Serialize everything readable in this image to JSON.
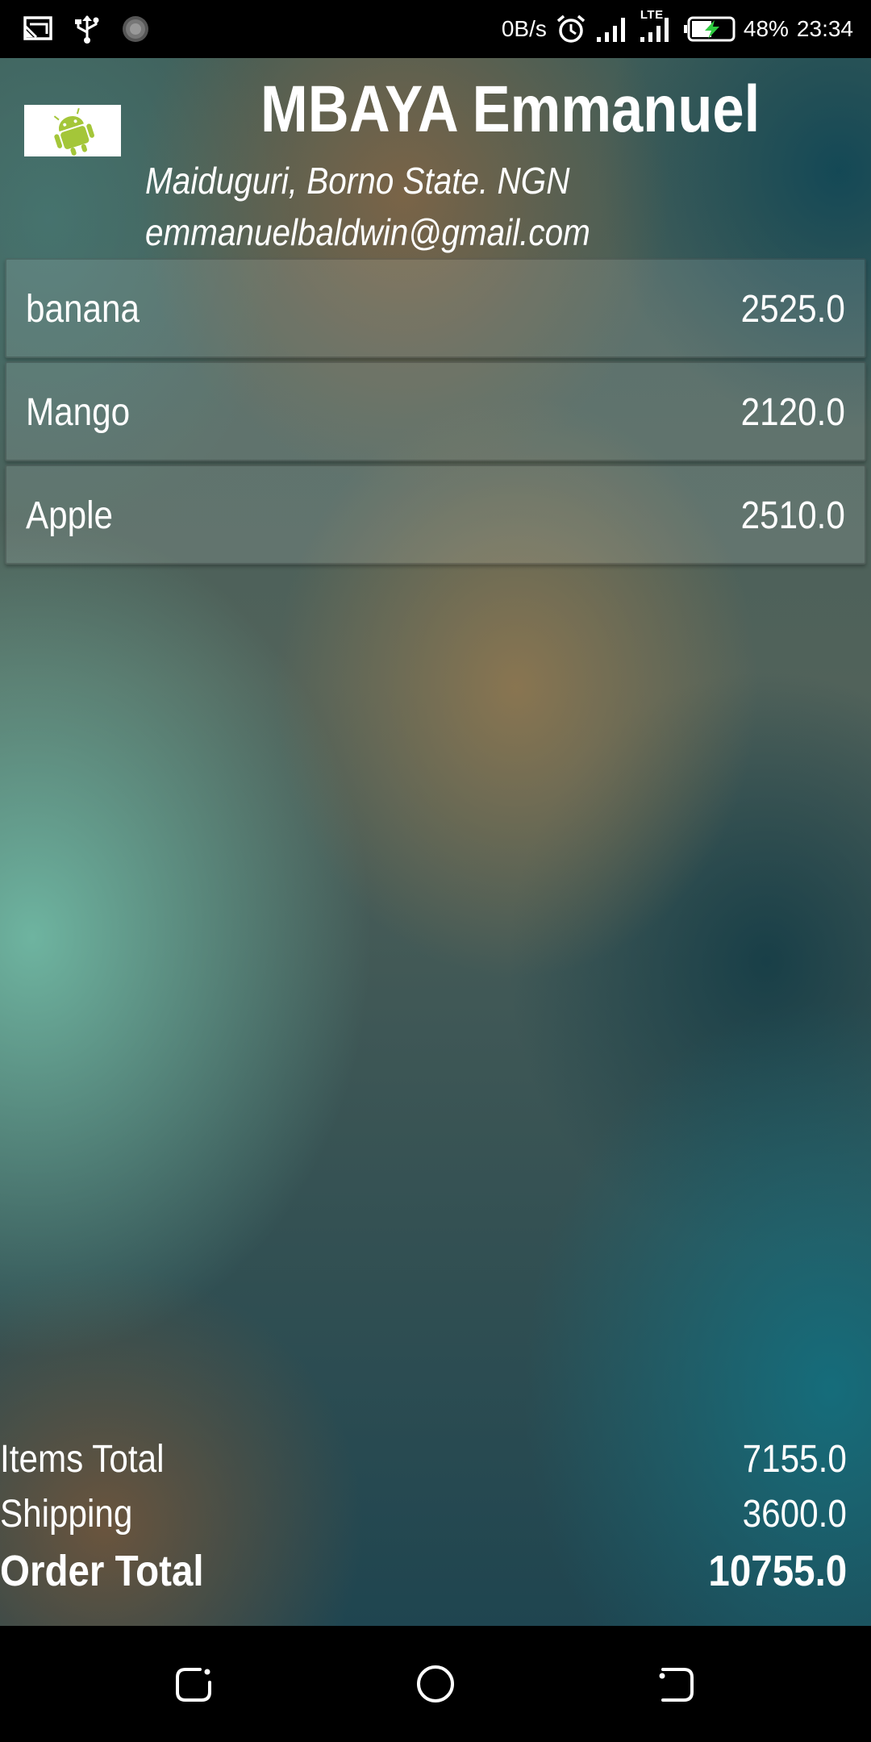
{
  "status_bar": {
    "network_speed": "0B/s",
    "network_type": "LTE",
    "battery": "48%",
    "time": "23:34",
    "icons": [
      "cast-icon",
      "usb-icon",
      "sync-icon",
      "alarm-icon",
      "signal-icon",
      "signal-lte-icon",
      "battery-charging-icon"
    ]
  },
  "header": {
    "logo_icon": "android-robot-icon",
    "name": "MBAYA Emmanuel",
    "location": "Maiduguri, Borno State. NGN",
    "email": "emmanuelbaldwin@gmail.com"
  },
  "order_items": [
    {
      "name": "banana",
      "price": "2525.0"
    },
    {
      "name": "Mango",
      "price": "2120.0"
    },
    {
      "name": "Apple",
      "price": "2510.0"
    }
  ],
  "totals": {
    "items_total_label": "Items Total",
    "items_total_value": "7155.0",
    "shipping_label": "Shipping",
    "shipping_value": "3600.0",
    "order_total_label": "Order Total",
    "order_total_value": "10755.0"
  },
  "nav_bar": {
    "buttons": [
      "back-icon",
      "home-icon",
      "recents-icon"
    ]
  },
  "colors": {
    "status_bar_bg": "#000000",
    "text": "#ffffff",
    "android_green": "#a4c639"
  }
}
